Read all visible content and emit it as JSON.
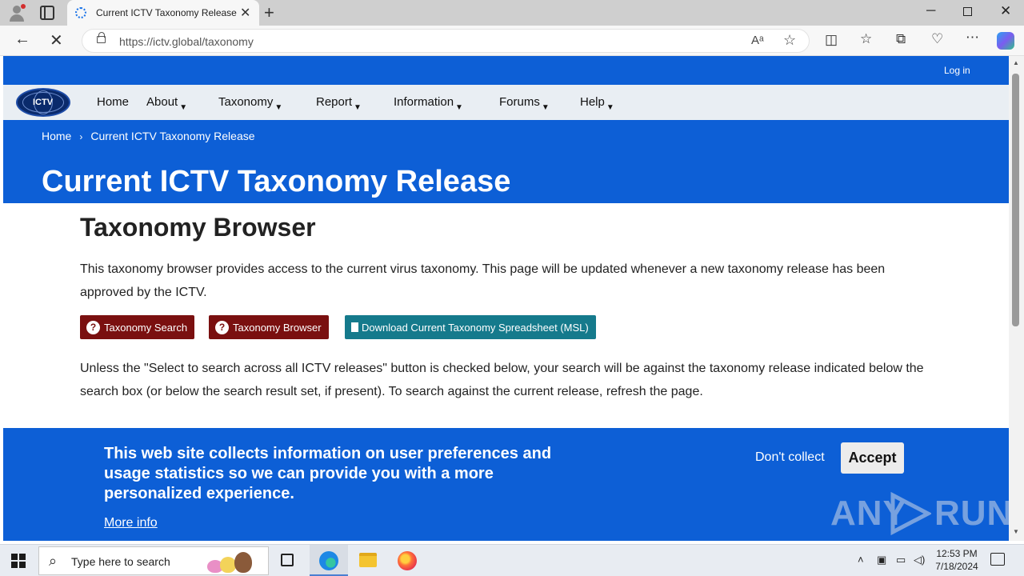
{
  "browser": {
    "tab_title": "Current ICTV Taxonomy Release |",
    "url": "https://ictv.global/taxonomy",
    "read_aloud_glyph": "Aᵃ",
    "favorite_glyph": "☆"
  },
  "site": {
    "logo_text": "ICTV",
    "login_label": "Log in",
    "nav": [
      {
        "label": "Home",
        "dropdown": false
      },
      {
        "label": "About",
        "dropdown": true
      },
      {
        "label": "Taxonomy",
        "dropdown": true
      },
      {
        "label": "Report",
        "dropdown": true
      },
      {
        "label": "Information",
        "dropdown": true
      },
      {
        "label": "Forums",
        "dropdown": true
      },
      {
        "label": "Help",
        "dropdown": true
      }
    ],
    "caret": "▼"
  },
  "hero": {
    "breadcrumb_home": "Home",
    "breadcrumb_sep": "›",
    "breadcrumb_current": "Current ICTV Taxonomy Release",
    "title": "Current ICTV Taxonomy Release"
  },
  "main": {
    "heading": "Taxonomy Browser",
    "intro": "This taxonomy browser provides access to the current virus taxonomy. This page will be updated whenever a new  taxonomy release has been approved by the ICTV.",
    "buttons": {
      "search": "Taxonomy Search",
      "browser": "Taxonomy Browser",
      "download": "Download Current Taxonomy Spreadsheet (MSL)"
    },
    "note": "Unless the \"Select to search across all ICTV releases\" button is checked below, your search will be against the taxonomy release indicated below the search box (or below the search result set, if present). To search against the current release, refresh the page."
  },
  "cookie": {
    "message": "This web site collects information on user preferences and usage statistics so we can provide you with a more personalized experience.",
    "more_info": "More info",
    "decline": "Don't collect",
    "accept": "Accept"
  },
  "watermark": {
    "left": "ANY",
    "right": "RUN"
  },
  "taskbar": {
    "search_placeholder": "Type here to search",
    "time": "12:53 PM",
    "date": "7/18/2024"
  },
  "colors": {
    "brand_blue": "#0d5fd6",
    "button_red": "#7a1010",
    "button_teal": "#157a8c",
    "nav_bg": "#e9eef3"
  },
  "icons": {
    "tab_loading": "spinner-icon",
    "back": "arrow-left-icon",
    "stop": "close-icon",
    "lock": "lock-icon",
    "question": "question-circle-icon",
    "download": "file-download-icon"
  }
}
